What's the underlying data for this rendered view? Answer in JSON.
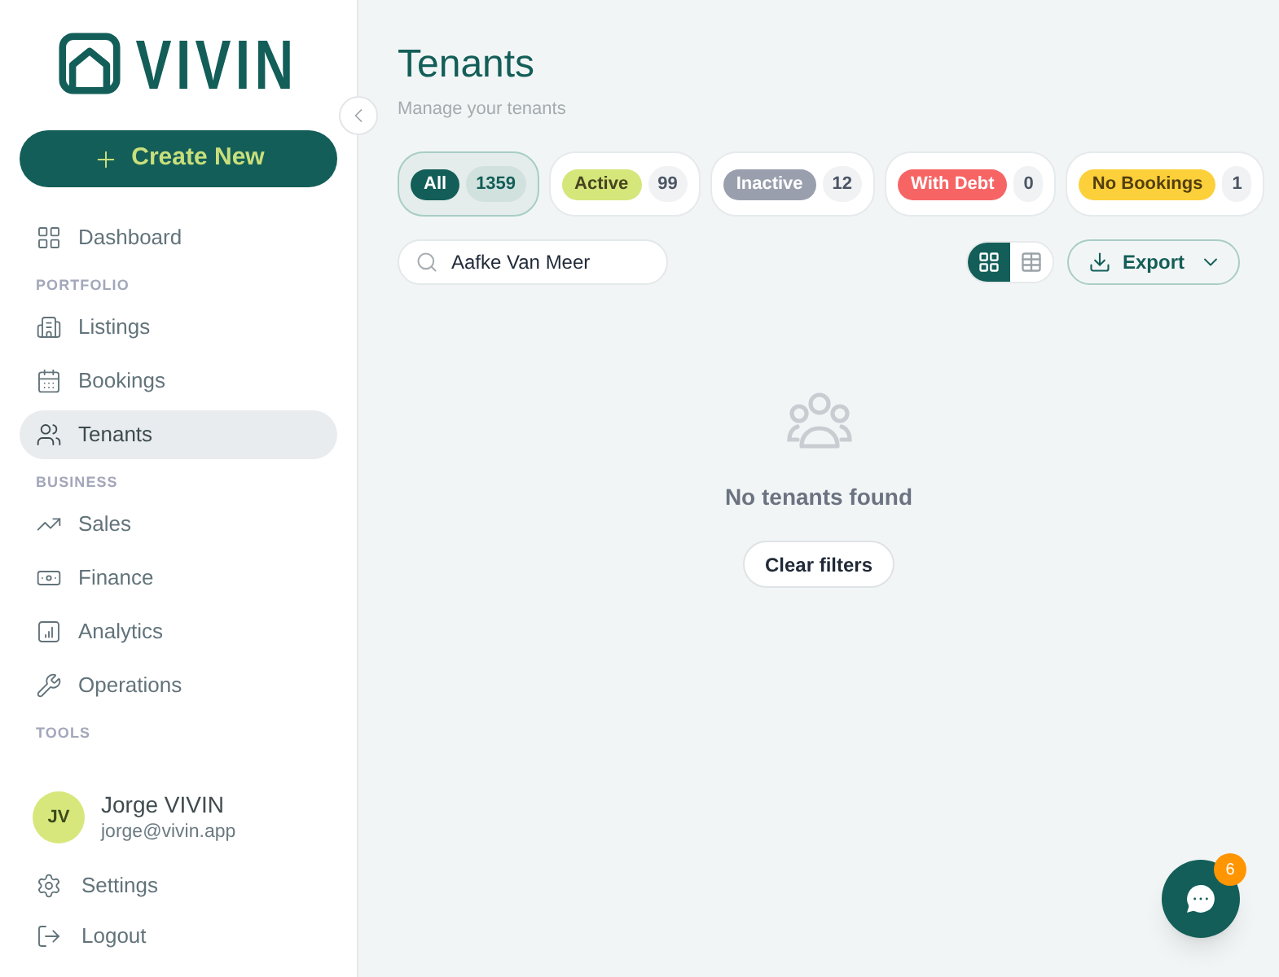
{
  "sidebar": {
    "logo": "VIVIN",
    "create_button": "Create New",
    "nav_groups": [
      {
        "items": [
          {
            "label": "Dashboard",
            "selected": false
          }
        ]
      },
      {
        "heading": "PORTFOLIO",
        "items": [
          {
            "label": "Listings",
            "selected": false
          },
          {
            "label": "Bookings",
            "selected": false
          },
          {
            "label": "Tenants",
            "selected": true
          }
        ]
      },
      {
        "heading": "BUSINESS",
        "items": [
          {
            "label": "Sales",
            "selected": false
          },
          {
            "label": "Finance",
            "selected": false
          },
          {
            "label": "Analytics",
            "selected": false
          },
          {
            "label": "Operations",
            "selected": false
          }
        ]
      },
      {
        "heading": "TOOLS"
      }
    ],
    "user": {
      "initials": "JV",
      "name": "Jorge VIVIN",
      "email": "jorge@vivin.app"
    },
    "footer_items": [
      {
        "label": "Settings"
      },
      {
        "label": "Logout"
      }
    ]
  },
  "header": {
    "title": "Tenants",
    "subtitle": "Manage your tenants"
  },
  "filters": [
    {
      "label": "All",
      "count": "1359",
      "selected": true,
      "color": "#135e58"
    },
    {
      "label": "Active",
      "count": "99",
      "selected": false,
      "color": "#d5e67b"
    },
    {
      "label": "Inactive",
      "count": "12",
      "selected": false,
      "color": "#9a9fae"
    },
    {
      "label": "With Debt",
      "count": "0",
      "selected": false,
      "color": "#f76464"
    },
    {
      "label": "No Bookings",
      "count": "1",
      "selected": false,
      "color": "#fcd03a"
    }
  ],
  "search": {
    "value": "Aafke Van Meer"
  },
  "view_modes": [
    {
      "kind": "grid",
      "selected": true
    },
    {
      "kind": "table",
      "selected": false
    }
  ],
  "export_button": "Export",
  "empty_state": {
    "message": "No tenants found",
    "button": "Clear filters"
  },
  "chat": {
    "badge": "6"
  }
}
